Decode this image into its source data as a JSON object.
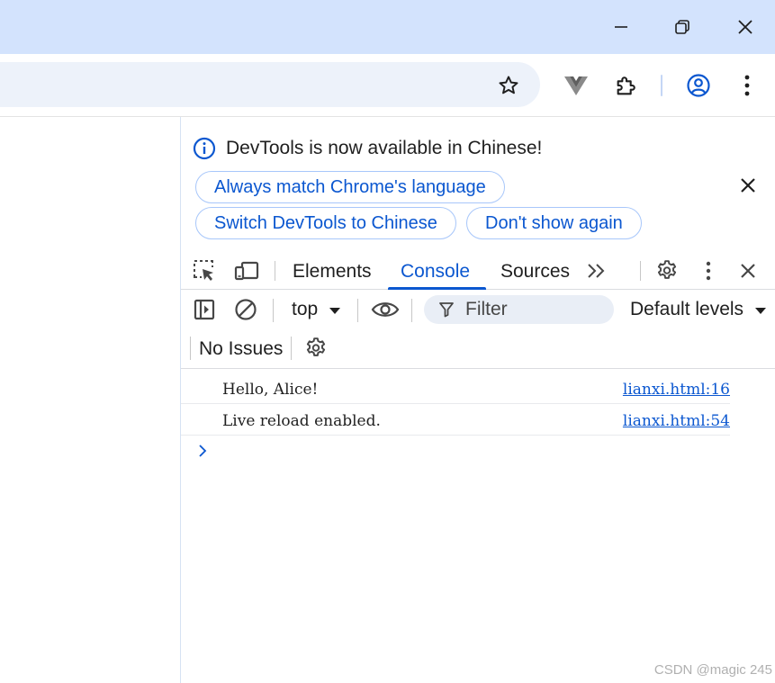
{
  "window": {
    "controls": [
      "minimize-icon",
      "restore-icon",
      "close-icon"
    ]
  },
  "toolbar": {
    "icons": [
      "star-icon",
      "vue-devtools-icon",
      "extensions-puzzle-icon",
      "profile-icon",
      "more-vert-icon"
    ]
  },
  "devtools": {
    "infobar": {
      "message": "DevTools is now available in Chinese!",
      "buttons": {
        "match": "Always match Chrome's language",
        "switch": "Switch DevTools to Chinese",
        "dismiss": "Don't show again"
      }
    },
    "tabs": {
      "elements": "Elements",
      "console": "Console",
      "sources": "Sources",
      "active": "Console"
    },
    "console_toolbar": {
      "context": "top",
      "filter_placeholder": "Filter",
      "levels": "Default levels",
      "issues": "No Issues"
    },
    "messages": [
      {
        "text": "Hello, Alice!",
        "source": "lianxi.html:16"
      },
      {
        "text": "Live reload enabled.",
        "source": "lianxi.html:54"
      }
    ]
  },
  "colors": {
    "titlebar": "#d3e3fd",
    "omnibox": "#edf2fa",
    "accent": "#0b57d0",
    "pill_border": "#a8c7fa",
    "filter_bg": "#e9eef6"
  },
  "watermark": "CSDN @magic 245"
}
